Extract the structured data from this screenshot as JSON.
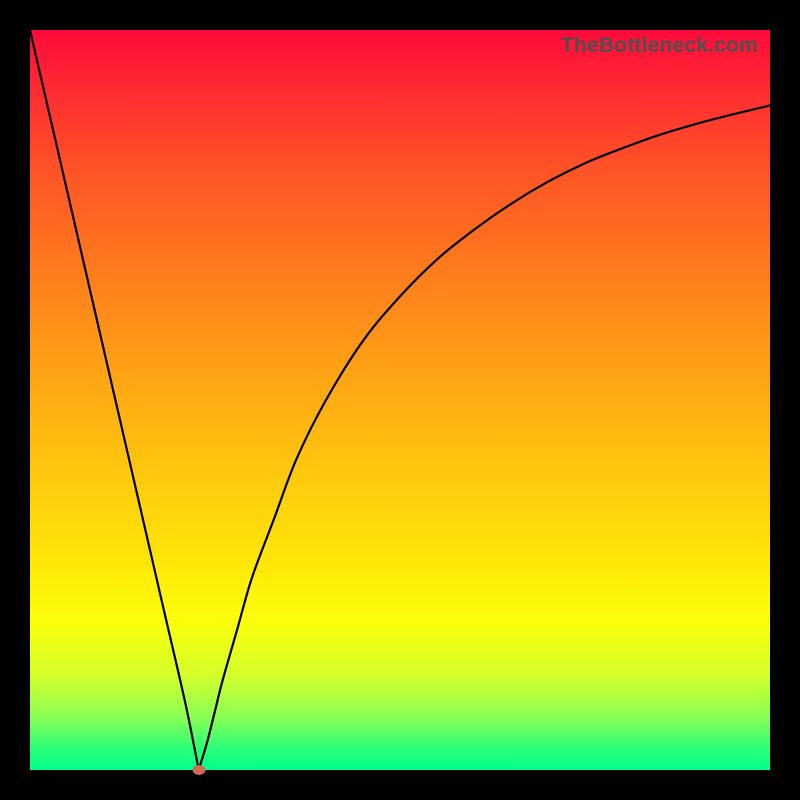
{
  "attribution": "TheBottleneck.com",
  "colors": {
    "frame": "#000000",
    "curve": "#000000",
    "marker": "#cf6a55",
    "gradient_top": "#ff0a3a",
    "gradient_bottom": "#00ff88"
  },
  "chart_data": {
    "type": "line",
    "title": "",
    "xlabel": "",
    "ylabel": "",
    "xlim": [
      0,
      100
    ],
    "ylim": [
      0,
      100
    ],
    "series": [
      {
        "name": "bottleneck-curve",
        "x": [
          0,
          3,
          6,
          9,
          12,
          15,
          18,
          21,
          22.8,
          24,
          25,
          26,
          28,
          30,
          33,
          36,
          40,
          45,
          50,
          55,
          60,
          65,
          70,
          75,
          80,
          85,
          90,
          95,
          100
        ],
        "values": [
          100,
          87,
          74,
          61,
          48,
          35,
          22,
          9,
          0,
          4,
          8,
          12,
          19,
          26,
          34,
          42,
          50,
          58,
          64,
          69,
          73,
          76.5,
          79.5,
          82,
          84,
          85.8,
          87.3,
          88.6,
          89.8
        ]
      }
    ],
    "annotations": [
      {
        "name": "minimum-marker",
        "x": 22.8,
        "y": 0
      }
    ]
  }
}
